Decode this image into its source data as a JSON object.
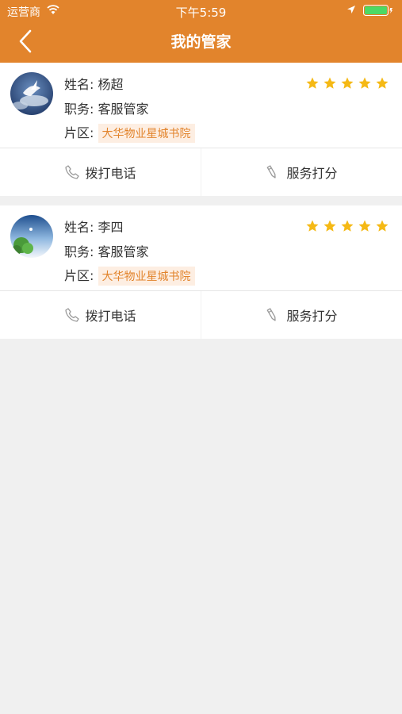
{
  "status_bar": {
    "carrier": "运营商",
    "time": "下午5:59"
  },
  "header": {
    "title": "我的管家",
    "color": "#e2842c"
  },
  "accent": "#e2842c",
  "star_color": "#f5b915",
  "butlers": [
    {
      "name_label": "姓名:",
      "name": "杨超",
      "role_label": "职务:",
      "role": "客服管家",
      "area_label": "片区:",
      "area": "大华物业星城书院",
      "rating": 5,
      "call_label": "拨打电话",
      "rate_label": "服务打分"
    },
    {
      "name_label": "姓名:",
      "name": "李四",
      "role_label": "职务:",
      "role": "客服管家",
      "area_label": "片区:",
      "area": "大华物业星城书院",
      "rating": 5,
      "call_label": "拨打电话",
      "rate_label": "服务打分"
    }
  ]
}
